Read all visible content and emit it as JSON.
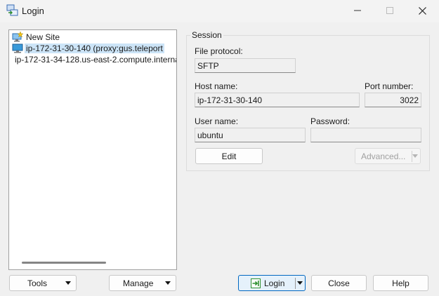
{
  "window": {
    "title": "Login"
  },
  "sites": [
    {
      "label": "New Site",
      "icon": "new-site-icon"
    },
    {
      "label": "ip-172-31-30-140 (proxy:gus.teleport",
      "icon": "computer-icon",
      "selected": true
    },
    {
      "label": "ip-172-31-34-128.us-east-2.compute.interna",
      "icon": "computer-icon"
    }
  ],
  "session": {
    "legend": "Session",
    "file_protocol_label": "File protocol:",
    "file_protocol_value": "SFTP",
    "host_name_label": "Host name:",
    "host_name_value": "ip-172-31-30-140",
    "port_label": "Port number:",
    "port_value": "3022",
    "user_name_label": "User name:",
    "user_name_value": "ubuntu",
    "password_label": "Password:",
    "password_value": "",
    "edit_label": "Edit",
    "advanced_label": "Advanced..."
  },
  "buttons": {
    "tools": "Tools",
    "manage": "Manage",
    "login": "Login",
    "close": "Close",
    "help": "Help"
  },
  "colors": {
    "selection": "#cce4f7",
    "accent": "#0067c0"
  }
}
